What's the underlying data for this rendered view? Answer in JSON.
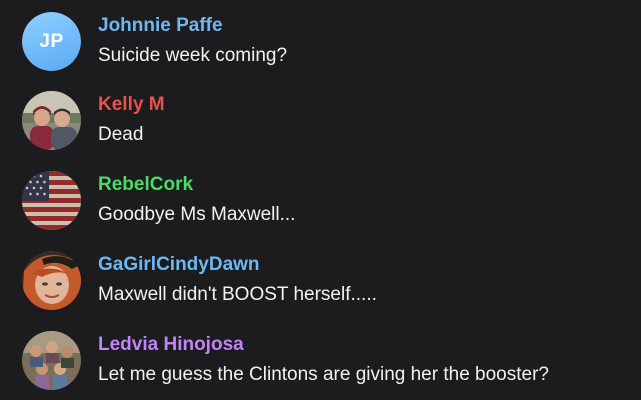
{
  "messages": [
    {
      "author": "Johnnie Paffe",
      "initials": "JP",
      "text": "Suicide week coming?",
      "name_color": "#6cb8f0",
      "avatar": "initials-avatar"
    },
    {
      "author": "Kelly M",
      "text": "Dead",
      "name_color": "#e8524a",
      "avatar": "photo-couple"
    },
    {
      "author": "RebelCork",
      "text": "Goodbye Ms Maxwell...",
      "name_color": "#4cd964",
      "avatar": "us-flag"
    },
    {
      "author": "GaGirlCindyDawn",
      "text": "Maxwell didn't BOOST herself.....",
      "name_color": "#6cb8f0",
      "avatar": "photo-woman"
    },
    {
      "author": "Ledvia Hinojosa",
      "text": "Let me guess the Clintons are giving her the booster?",
      "name_color": "#c084f5",
      "avatar": "photo-family"
    }
  ]
}
